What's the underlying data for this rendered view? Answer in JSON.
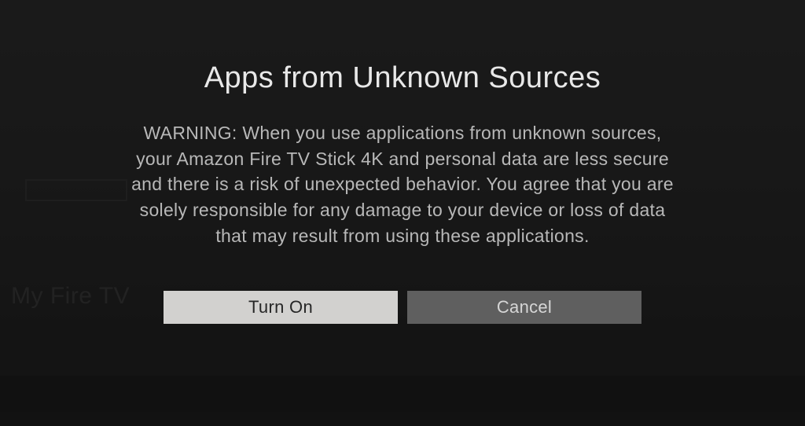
{
  "background": {
    "menu_label": "My Fire TV"
  },
  "dialog": {
    "title": "Apps from Unknown Sources",
    "body": "WARNING: When you use applications from unknown sources, your Amazon Fire TV Stick 4K and personal data are less secure and there is a risk of unexpected behavior. You agree that you are solely responsible for any damage to your device or loss of data that may result from using these applications.",
    "buttons": {
      "confirm": "Turn On",
      "cancel": "Cancel"
    }
  }
}
